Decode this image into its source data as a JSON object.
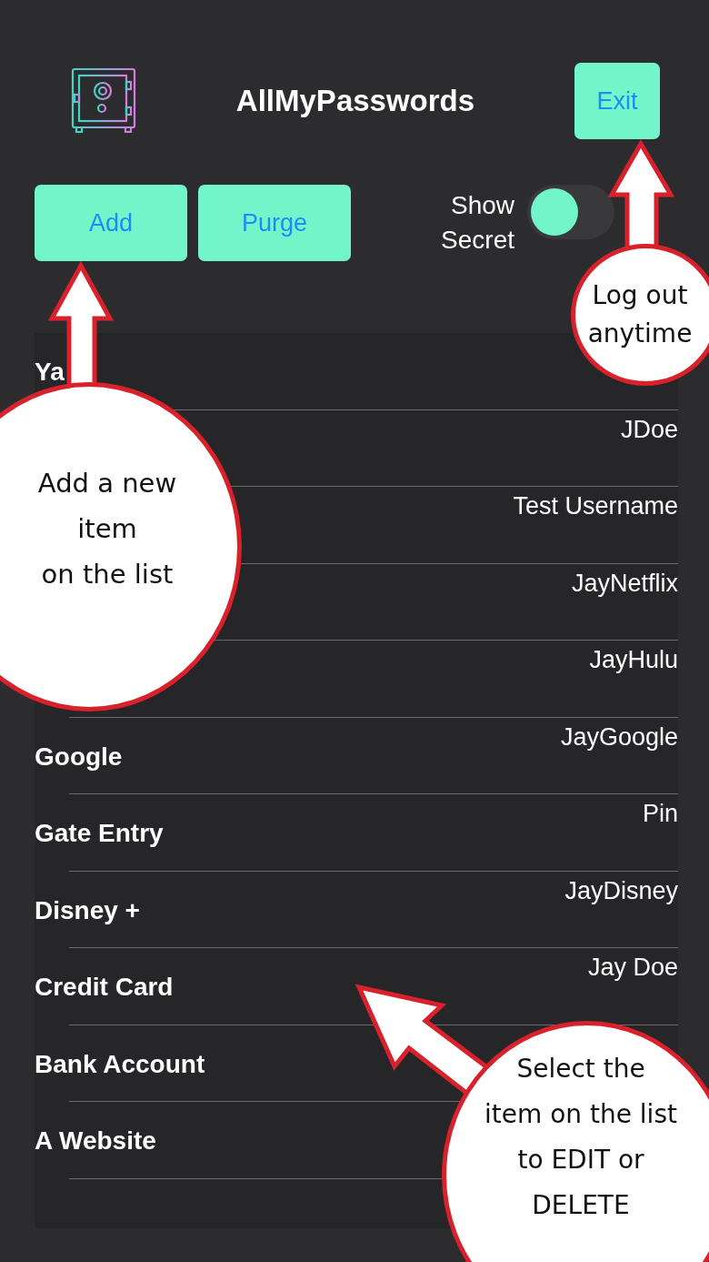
{
  "header": {
    "title": "AllMyPasswords",
    "exit_button": "Exit"
  },
  "actions": {
    "buttons": [
      "Add",
      "Purge"
    ],
    "toggle": {
      "label": "Show Secret",
      "on": false
    }
  },
  "entries": [
    {
      "name": "Ya"
    },
    {
      "username": "JDoe"
    },
    {
      "username": "Test Username"
    },
    {
      "username": "JayNetflix"
    },
    {
      "username": "JayHulu"
    },
    {
      "name": "Google",
      "username": "JayGoogle"
    },
    {
      "name": "Gate Entry",
      "username": "Pin"
    },
    {
      "name": "Disney +",
      "username": "JayDisney"
    },
    {
      "name": "Credit Card",
      "username": "Jay Doe"
    },
    {
      "name": "Bank Account"
    },
    {
      "name": "A Website"
    }
  ],
  "callouts": [
    {
      "kind": "top-right",
      "text": "Log out\nanytime"
    },
    {
      "kind": "left",
      "text": "Add a new\nitem\non the list"
    },
    {
      "kind": "bottom-right",
      "text": "Select the\nitem on the list\nto EDIT or\nDELETE"
    }
  ]
}
